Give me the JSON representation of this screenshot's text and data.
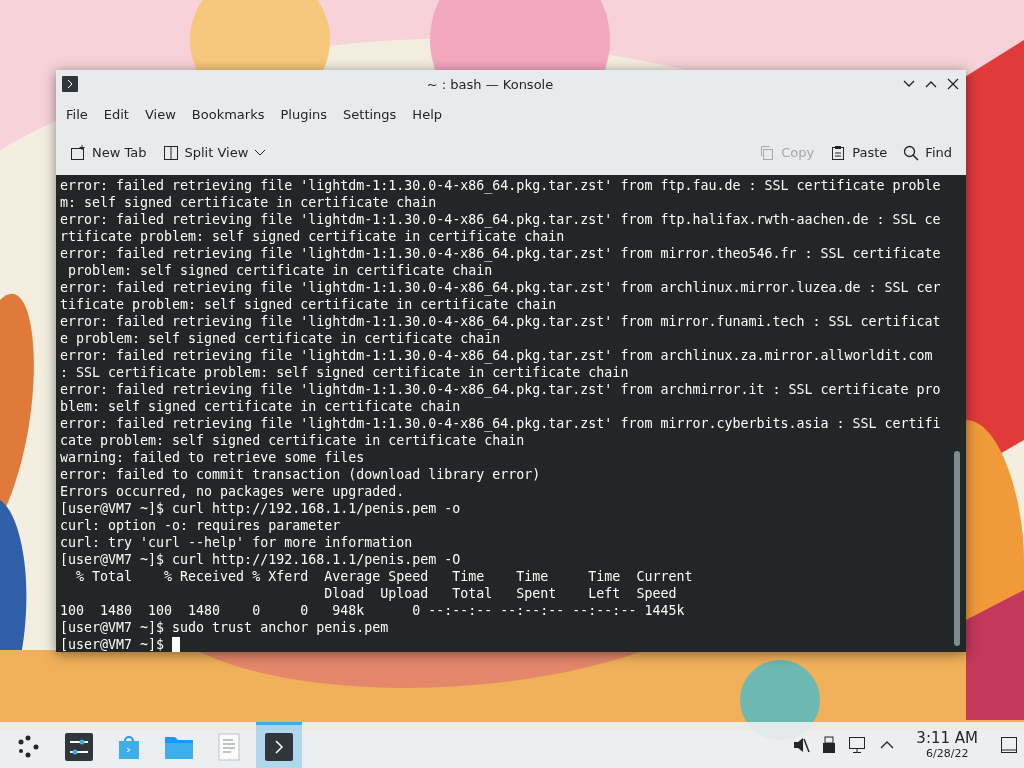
{
  "window": {
    "title": "~ : bash — Konsole"
  },
  "menu": [
    "File",
    "Edit",
    "View",
    "Bookmarks",
    "Plugins",
    "Settings",
    "Help"
  ],
  "toolbar": {
    "left": [
      {
        "kind": "new-tab",
        "label": "New Tab",
        "disabled": false
      },
      {
        "kind": "split",
        "label": "Split View",
        "disabled": false
      }
    ],
    "right": [
      {
        "kind": "copy",
        "label": "Copy",
        "disabled": true
      },
      {
        "kind": "paste",
        "label": "Paste",
        "disabled": false
      },
      {
        "kind": "find",
        "label": "Find",
        "disabled": false
      }
    ]
  },
  "terminal": {
    "lines": [
      "error: failed retrieving file 'lightdm-1:1.30.0-4-x86_64.pkg.tar.zst' from ftp.fau.de : SSL certificate proble",
      "m: self signed certificate in certificate chain",
      "error: failed retrieving file 'lightdm-1:1.30.0-4-x86_64.pkg.tar.zst' from ftp.halifax.rwth-aachen.de : SSL ce",
      "rtificate problem: self signed certificate in certificate chain",
      "error: failed retrieving file 'lightdm-1:1.30.0-4-x86_64.pkg.tar.zst' from mirror.theo546.fr : SSL certificate",
      " problem: self signed certificate in certificate chain",
      "error: failed retrieving file 'lightdm-1:1.30.0-4-x86_64.pkg.tar.zst' from archlinux.mirror.luzea.de : SSL cer",
      "tificate problem: self signed certificate in certificate chain",
      "error: failed retrieving file 'lightdm-1:1.30.0-4-x86_64.pkg.tar.zst' from mirror.funami.tech : SSL certificat",
      "e problem: self signed certificate in certificate chain",
      "error: failed retrieving file 'lightdm-1:1.30.0-4-x86_64.pkg.tar.zst' from archlinux.za.mirror.allworldit.com",
      ": SSL certificate problem: self signed certificate in certificate chain",
      "error: failed retrieving file 'lightdm-1:1.30.0-4-x86_64.pkg.tar.zst' from archmirror.it : SSL certificate pro",
      "blem: self signed certificate in certificate chain",
      "error: failed retrieving file 'lightdm-1:1.30.0-4-x86_64.pkg.tar.zst' from mirror.cyberbits.asia : SSL certifi",
      "cate problem: self signed certificate in certificate chain",
      "warning: failed to retrieve some files",
      "error: failed to commit transaction (download library error)",
      "Errors occurred, no packages were upgraded.",
      "[user@VM7 ~]$ curl http://192.168.1.1/penis.pem -o",
      "curl: option -o: requires parameter",
      "curl: try 'curl --help' for more information",
      "[user@VM7 ~]$ curl http://192.168.1.1/penis.pem -O",
      "  % Total    % Received % Xferd  Average Speed   Time    Time     Time  Current",
      "                                 Dload  Upload   Total   Spent    Left  Speed",
      "100  1480  100  1480    0     0   948k      0 --:--:-- --:--:-- --:--:-- 1445k",
      "[user@VM7 ~]$ sudo trust anchor penis.pem"
    ],
    "prompt": {
      "text": "[user@VM7 ~]$",
      "cursor": true
    }
  },
  "taskbar": {
    "apps": [
      {
        "kind": "settings",
        "selected": false
      },
      {
        "kind": "store",
        "selected": false
      },
      {
        "kind": "folder",
        "selected": false
      },
      {
        "kind": "document",
        "selected": false
      },
      {
        "kind": "terminal",
        "selected": true
      }
    ],
    "time": "3:11 AM",
    "date": "6/28/22"
  }
}
